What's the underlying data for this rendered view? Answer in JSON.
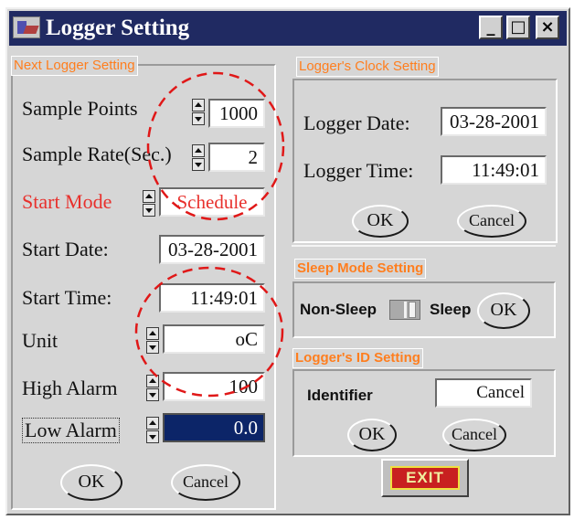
{
  "window": {
    "title": "Logger Setting",
    "minimize": "_",
    "maximize": "□",
    "close": "×"
  },
  "next_logger": {
    "group_label": "Next Logger Setting",
    "sample_points": {
      "label": "Sample Points",
      "value": "1000"
    },
    "sample_rate": {
      "label": "Sample Rate(Sec.)",
      "value": "2"
    },
    "start_mode": {
      "label": "Start Mode",
      "value": "Schedule"
    },
    "start_date": {
      "label": "Start Date:",
      "value": "03-28-2001"
    },
    "start_time": {
      "label": "Start Time:",
      "value": "11:49:01"
    },
    "unit": {
      "label": "Unit",
      "value": "oC"
    },
    "high_alarm": {
      "label": "High Alarm",
      "value": "100"
    },
    "low_alarm": {
      "label": "Low Alarm",
      "value": "0.0"
    },
    "ok": "OK",
    "cancel": "Cancel"
  },
  "clock": {
    "group_label": "Logger's Clock Setting",
    "date": {
      "label": "Logger Date:",
      "value": "03-28-2001"
    },
    "time": {
      "label": "Logger Time:",
      "value": "11:49:01"
    },
    "ok": "OK",
    "cancel": "Cancel"
  },
  "sleep": {
    "group_label": "Sleep Mode Setting",
    "non_sleep": "Non-Sleep",
    "sleep": "Sleep",
    "ok": "OK"
  },
  "id_setting": {
    "group_label": "Logger's ID Setting",
    "identifier_label": "Identifier",
    "identifier_value": "Cancel",
    "ok": "OK",
    "cancel": "Cancel"
  },
  "exit": "EXIT",
  "colors": {
    "title_bar": "#202a62",
    "group_label": "#ff7e1e",
    "start_mode": "#e8302c",
    "selected_field": "#0c2568",
    "annotation": "#e01818"
  }
}
